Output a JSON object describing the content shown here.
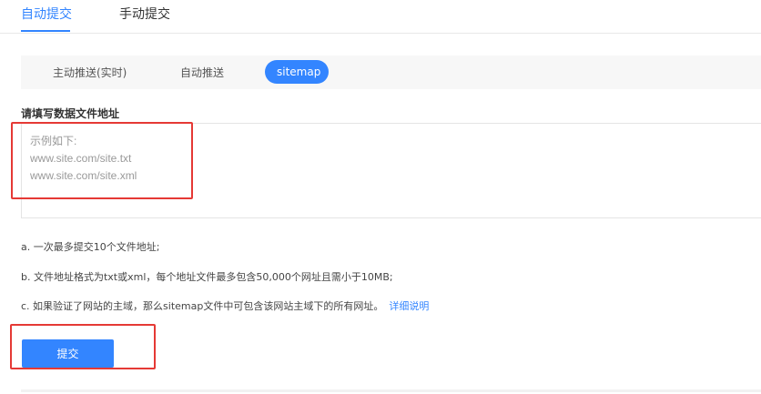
{
  "top_tabs": [
    {
      "label": "自动提交",
      "active": true
    },
    {
      "label": "手动提交",
      "active": false
    }
  ],
  "sub_tabs": [
    {
      "label": "主动推送(实时)",
      "active": false
    },
    {
      "label": "自动推送",
      "active": false
    },
    {
      "label": "sitemap",
      "active": true
    }
  ],
  "form": {
    "label": "请填写数据文件地址",
    "textarea_value": "",
    "placeholder_lines": [
      "示例如下:",
      "www.site.com/site.txt",
      "www.site.com/site.xml"
    ]
  },
  "notes": {
    "a": "a. 一次最多提交10个文件地址;",
    "b": "b. 文件地址格式为txt或xml，每个地址文件最多包含50,000个网址且需小于10MB;",
    "c": "c. 如果验证了网站的主域，那么sitemap文件中可包含该网站主域下的所有网址。",
    "c_link": "详细说明"
  },
  "submit_label": "提交",
  "colors": {
    "accent": "#3385ff",
    "highlight": "#e53935"
  }
}
